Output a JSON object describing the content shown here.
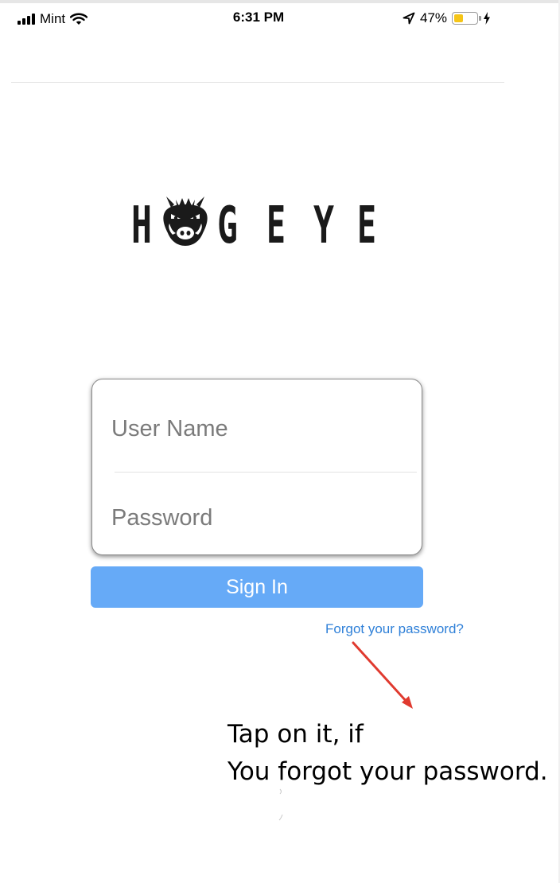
{
  "status_bar": {
    "carrier": "Mint",
    "time": "6:31 PM",
    "battery_percent_text": "47%",
    "battery_level": 0.47,
    "icons": [
      "signal-bars-icon",
      "wifi-icon",
      "location-arrow-icon",
      "battery-icon",
      "charging-bolt-icon"
    ]
  },
  "logo": {
    "text": "HOGEYE",
    "letters": [
      "H",
      "G",
      "E",
      "Y",
      "E"
    ],
    "icon": "boar-head-icon"
  },
  "login_form": {
    "username_placeholder": "User Name",
    "password_placeholder": "Password"
  },
  "sign_in_button": {
    "label": "Sign In"
  },
  "forgot_password_link": {
    "label": "Forgot your password?"
  },
  "annotation": {
    "line1": "Tap on it, if",
    "line2": "You forgot your password."
  },
  "colors": {
    "button": "#66aaf7",
    "link": "#2f80d8",
    "arrow": "#e03a2f",
    "battery_fill": "#f5c518"
  }
}
